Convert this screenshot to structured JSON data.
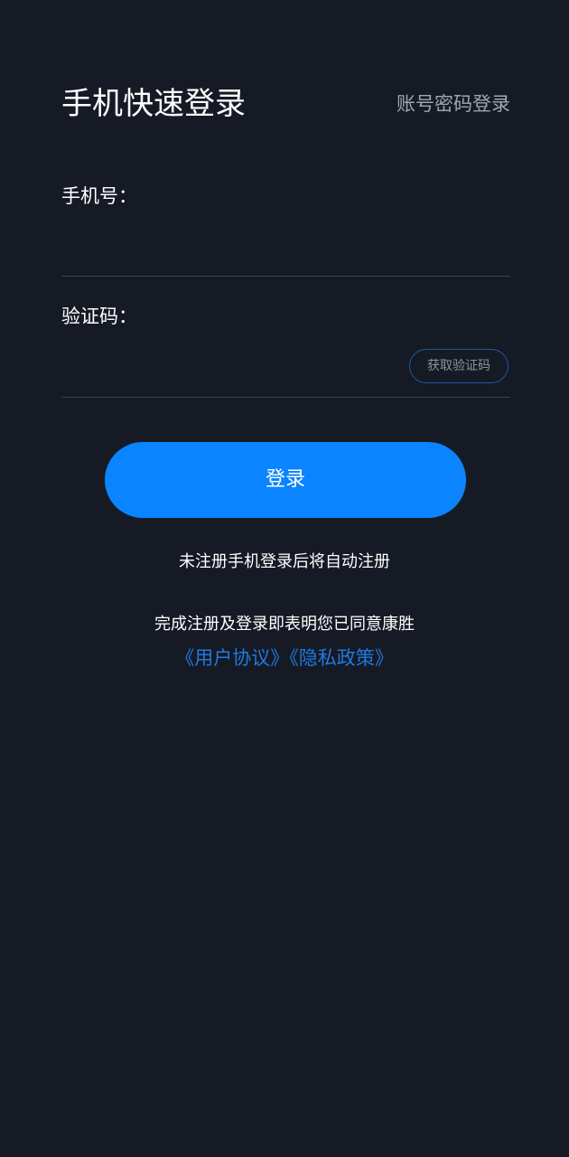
{
  "header": {
    "title": "手机快速登录",
    "switch_label": "账号密码登录"
  },
  "form": {
    "phone_label": "手机号：",
    "phone_value": "",
    "code_label": "验证码：",
    "code_value": "",
    "get_code_label": "获取验证码",
    "login_label": "登录"
  },
  "footer": {
    "auto_register": "未注册手机登录后将自动注册",
    "agreement_prefix": "完成注册及登录即表明您已同意康胜",
    "user_agreement": "《用户协议》",
    "privacy_policy": "《隐私政策》"
  },
  "colors": {
    "background": "#161a24",
    "accent": "#0a84ff",
    "link": "#1f7ae0"
  }
}
